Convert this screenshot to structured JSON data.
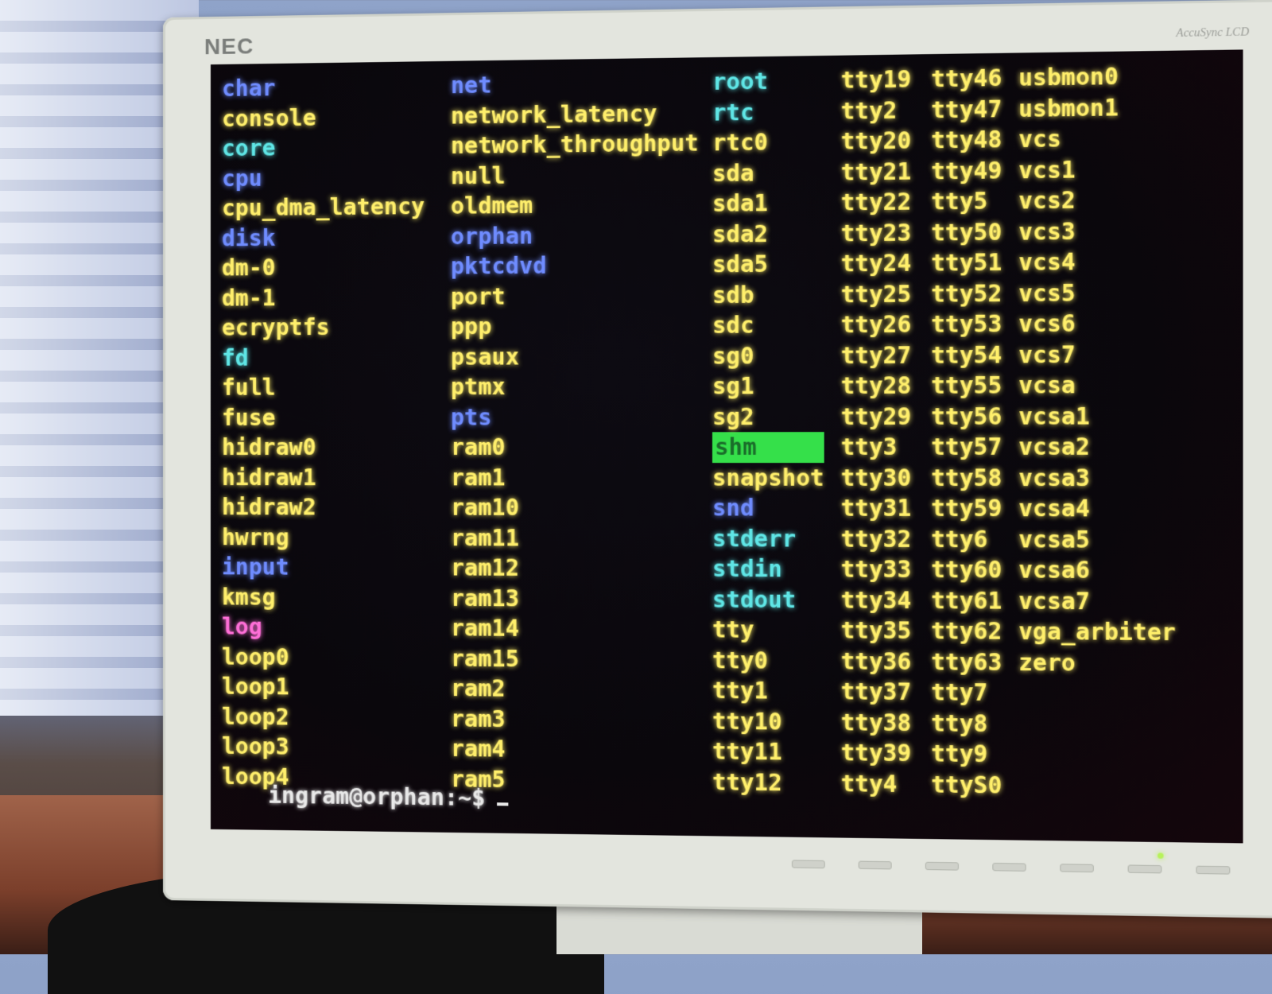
{
  "monitor": {
    "brand": "NEC",
    "model": "AccuSync LCD"
  },
  "terminal": {
    "columns": [
      [
        {
          "name": "char",
          "type": "dir"
        },
        {
          "name": "console",
          "type": "file"
        },
        {
          "name": "core",
          "type": "link"
        },
        {
          "name": "cpu",
          "type": "dir"
        },
        {
          "name": "cpu_dma_latency",
          "type": "file"
        },
        {
          "name": "disk",
          "type": "dir"
        },
        {
          "name": "dm-0",
          "type": "file"
        },
        {
          "name": "dm-1",
          "type": "file"
        },
        {
          "name": "ecryptfs",
          "type": "file"
        },
        {
          "name": "fd",
          "type": "link"
        },
        {
          "name": "full",
          "type": "file"
        },
        {
          "name": "fuse",
          "type": "file"
        },
        {
          "name": "hidraw0",
          "type": "file"
        },
        {
          "name": "hidraw1",
          "type": "file"
        },
        {
          "name": "hidraw2",
          "type": "file"
        },
        {
          "name": "hwrng",
          "type": "file"
        },
        {
          "name": "input",
          "type": "dir"
        },
        {
          "name": "kmsg",
          "type": "file"
        },
        {
          "name": "log",
          "type": "sock"
        },
        {
          "name": "loop0",
          "type": "file"
        },
        {
          "name": "loop1",
          "type": "file"
        },
        {
          "name": "loop2",
          "type": "file"
        },
        {
          "name": "loop3",
          "type": "file"
        },
        {
          "name": "loop4",
          "type": "file"
        }
      ],
      [
        {
          "name": "net",
          "type": "dir"
        },
        {
          "name": "network_latency",
          "type": "file"
        },
        {
          "name": "network_throughput",
          "type": "file"
        },
        {
          "name": "null",
          "type": "file"
        },
        {
          "name": "oldmem",
          "type": "file"
        },
        {
          "name": "orphan",
          "type": "dir"
        },
        {
          "name": "pktcdvd",
          "type": "dir"
        },
        {
          "name": "port",
          "type": "file"
        },
        {
          "name": "ppp",
          "type": "file"
        },
        {
          "name": "psaux",
          "type": "file"
        },
        {
          "name": "ptmx",
          "type": "file"
        },
        {
          "name": "pts",
          "type": "dir"
        },
        {
          "name": "ram0",
          "type": "file"
        },
        {
          "name": "ram1",
          "type": "file"
        },
        {
          "name": "ram10",
          "type": "file"
        },
        {
          "name": "ram11",
          "type": "file"
        },
        {
          "name": "ram12",
          "type": "file"
        },
        {
          "name": "ram13",
          "type": "file"
        },
        {
          "name": "ram14",
          "type": "file"
        },
        {
          "name": "ram15",
          "type": "file"
        },
        {
          "name": "ram2",
          "type": "file"
        },
        {
          "name": "ram3",
          "type": "file"
        },
        {
          "name": "ram4",
          "type": "file"
        },
        {
          "name": "ram5",
          "type": "file"
        }
      ],
      [
        {
          "name": "root",
          "type": "link"
        },
        {
          "name": "rtc",
          "type": "link"
        },
        {
          "name": "rtc0",
          "type": "file"
        },
        {
          "name": "sda",
          "type": "file"
        },
        {
          "name": "sda1",
          "type": "file"
        },
        {
          "name": "sda2",
          "type": "file"
        },
        {
          "name": "sda5",
          "type": "file"
        },
        {
          "name": "sdb",
          "type": "file"
        },
        {
          "name": "sdc",
          "type": "file"
        },
        {
          "name": "sg0",
          "type": "file"
        },
        {
          "name": "sg1",
          "type": "file"
        },
        {
          "name": "sg2",
          "type": "file"
        },
        {
          "name": "shm",
          "type": "sticky"
        },
        {
          "name": "snapshot",
          "type": "file"
        },
        {
          "name": "snd",
          "type": "dir"
        },
        {
          "name": "stderr",
          "type": "link"
        },
        {
          "name": "stdin",
          "type": "link"
        },
        {
          "name": "stdout",
          "type": "link"
        },
        {
          "name": "tty",
          "type": "file"
        },
        {
          "name": "tty0",
          "type": "file"
        },
        {
          "name": "tty1",
          "type": "file"
        },
        {
          "name": "tty10",
          "type": "file"
        },
        {
          "name": "tty11",
          "type": "file"
        },
        {
          "name": "tty12",
          "type": "file"
        }
      ],
      [
        {
          "name": "tty19",
          "type": "file"
        },
        {
          "name": "tty2",
          "type": "file"
        },
        {
          "name": "tty20",
          "type": "file"
        },
        {
          "name": "tty21",
          "type": "file"
        },
        {
          "name": "tty22",
          "type": "file"
        },
        {
          "name": "tty23",
          "type": "file"
        },
        {
          "name": "tty24",
          "type": "file"
        },
        {
          "name": "tty25",
          "type": "file"
        },
        {
          "name": "tty26",
          "type": "file"
        },
        {
          "name": "tty27",
          "type": "file"
        },
        {
          "name": "tty28",
          "type": "file"
        },
        {
          "name": "tty29",
          "type": "file"
        },
        {
          "name": "tty3",
          "type": "file"
        },
        {
          "name": "tty30",
          "type": "file"
        },
        {
          "name": "tty31",
          "type": "file"
        },
        {
          "name": "tty32",
          "type": "file"
        },
        {
          "name": "tty33",
          "type": "file"
        },
        {
          "name": "tty34",
          "type": "file"
        },
        {
          "name": "tty35",
          "type": "file"
        },
        {
          "name": "tty36",
          "type": "file"
        },
        {
          "name": "tty37",
          "type": "file"
        },
        {
          "name": "tty38",
          "type": "file"
        },
        {
          "name": "tty39",
          "type": "file"
        },
        {
          "name": "tty4",
          "type": "file"
        }
      ],
      [
        {
          "name": "tty46",
          "type": "file"
        },
        {
          "name": "tty47",
          "type": "file"
        },
        {
          "name": "tty48",
          "type": "file"
        },
        {
          "name": "tty49",
          "type": "file"
        },
        {
          "name": "tty5",
          "type": "file"
        },
        {
          "name": "tty50",
          "type": "file"
        },
        {
          "name": "tty51",
          "type": "file"
        },
        {
          "name": "tty52",
          "type": "file"
        },
        {
          "name": "tty53",
          "type": "file"
        },
        {
          "name": "tty54",
          "type": "file"
        },
        {
          "name": "tty55",
          "type": "file"
        },
        {
          "name": "tty56",
          "type": "file"
        },
        {
          "name": "tty57",
          "type": "file"
        },
        {
          "name": "tty58",
          "type": "file"
        },
        {
          "name": "tty59",
          "type": "file"
        },
        {
          "name": "tty6",
          "type": "file"
        },
        {
          "name": "tty60",
          "type": "file"
        },
        {
          "name": "tty61",
          "type": "file"
        },
        {
          "name": "tty62",
          "type": "file"
        },
        {
          "name": "tty63",
          "type": "file"
        },
        {
          "name": "tty7",
          "type": "file"
        },
        {
          "name": "tty8",
          "type": "file"
        },
        {
          "name": "tty9",
          "type": "file"
        },
        {
          "name": "ttyS0",
          "type": "file"
        }
      ],
      [
        {
          "name": "usbmon0",
          "type": "file"
        },
        {
          "name": "usbmon1",
          "type": "file"
        },
        {
          "name": "vcs",
          "type": "file"
        },
        {
          "name": "vcs1",
          "type": "file"
        },
        {
          "name": "vcs2",
          "type": "file"
        },
        {
          "name": "vcs3",
          "type": "file"
        },
        {
          "name": "vcs4",
          "type": "file"
        },
        {
          "name": "vcs5",
          "type": "file"
        },
        {
          "name": "vcs6",
          "type": "file"
        },
        {
          "name": "vcs7",
          "type": "file"
        },
        {
          "name": "vcsa",
          "type": "file"
        },
        {
          "name": "vcsa1",
          "type": "file"
        },
        {
          "name": "vcsa2",
          "type": "file"
        },
        {
          "name": "vcsa3",
          "type": "file"
        },
        {
          "name": "vcsa4",
          "type": "file"
        },
        {
          "name": "vcsa5",
          "type": "file"
        },
        {
          "name": "vcsa6",
          "type": "file"
        },
        {
          "name": "vcsa7",
          "type": "file"
        },
        {
          "name": "vga_arbiter",
          "type": "file"
        },
        {
          "name": "zero",
          "type": "file"
        }
      ]
    ],
    "prompt": "ingram@orphan:~$"
  },
  "colors": {
    "file": "#ffef6b",
    "dir": "#6f8cff",
    "link": "#5fe6e6",
    "sock": "#ff6fd8",
    "sticky_bg": "#35e04a",
    "background": "#0a070c"
  }
}
